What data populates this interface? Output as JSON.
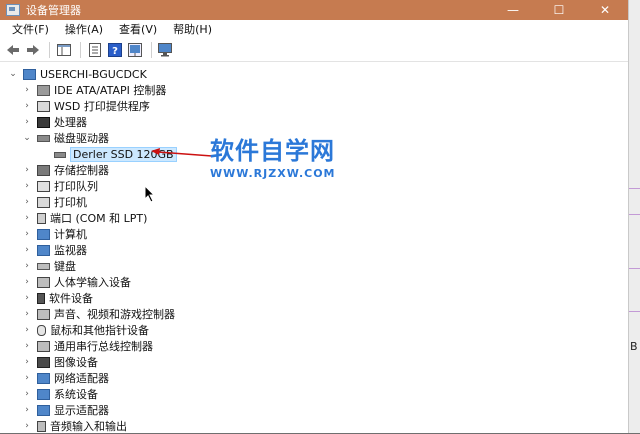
{
  "window": {
    "title": "设备管理器",
    "buttons": {
      "minimize": "—",
      "maximize": "☐",
      "close": "✕"
    }
  },
  "menu": [
    "文件(F)",
    "操作(A)",
    "查看(V)",
    "帮助(H)"
  ],
  "tree": {
    "root": "USERCHI-BGUCDCK",
    "items": [
      {
        "label": "IDE ATA/ATAPI 控制器",
        "icon": "ide-controller-icon",
        "expanded": false
      },
      {
        "label": "WSD 打印提供程序",
        "icon": "printer-icon",
        "expanded": false
      },
      {
        "label": "处理器",
        "icon": "processor-icon",
        "expanded": false
      },
      {
        "label": "磁盘驱动器",
        "icon": "disk-drive-icon",
        "expanded": true
      },
      {
        "label": "存储控制器",
        "icon": "storage-controller-icon",
        "expanded": false
      },
      {
        "label": "打印队列",
        "icon": "print-queue-icon",
        "expanded": false
      },
      {
        "label": "打印机",
        "icon": "printer-icon",
        "expanded": false
      },
      {
        "label": "端口 (COM 和 LPT)",
        "icon": "port-icon",
        "expanded": false
      },
      {
        "label": "计算机",
        "icon": "computer-icon",
        "expanded": false
      },
      {
        "label": "监视器",
        "icon": "monitor-icon",
        "expanded": false
      },
      {
        "label": "键盘",
        "icon": "keyboard-icon",
        "expanded": false
      },
      {
        "label": "人体学输入设备",
        "icon": "hid-icon",
        "expanded": false
      },
      {
        "label": "软件设备",
        "icon": "software-device-icon",
        "expanded": false
      },
      {
        "label": "声音、视频和游戏控制器",
        "icon": "sound-icon",
        "expanded": false
      },
      {
        "label": "鼠标和其他指针设备",
        "icon": "mouse-icon",
        "expanded": false
      },
      {
        "label": "通用串行总线控制器",
        "icon": "usb-icon",
        "expanded": false
      },
      {
        "label": "图像设备",
        "icon": "camera-icon",
        "expanded": false
      },
      {
        "label": "网络适配器",
        "icon": "network-adapter-icon",
        "expanded": false
      },
      {
        "label": "系统设备",
        "icon": "system-device-icon",
        "expanded": false
      },
      {
        "label": "显示适配器",
        "icon": "display-adapter-icon",
        "expanded": false
      },
      {
        "label": "音频输入和输出",
        "icon": "audio-icon",
        "expanded": false
      }
    ],
    "disk_child": "Derler SSD 120GB"
  },
  "watermark": {
    "title": "软件自学网",
    "url": "WWW.RJZXW.COM"
  },
  "side_letter": "B",
  "colors": {
    "titlebar": "#c67b50",
    "watermark": "#2b78d8",
    "arrow": "#cc1111"
  }
}
